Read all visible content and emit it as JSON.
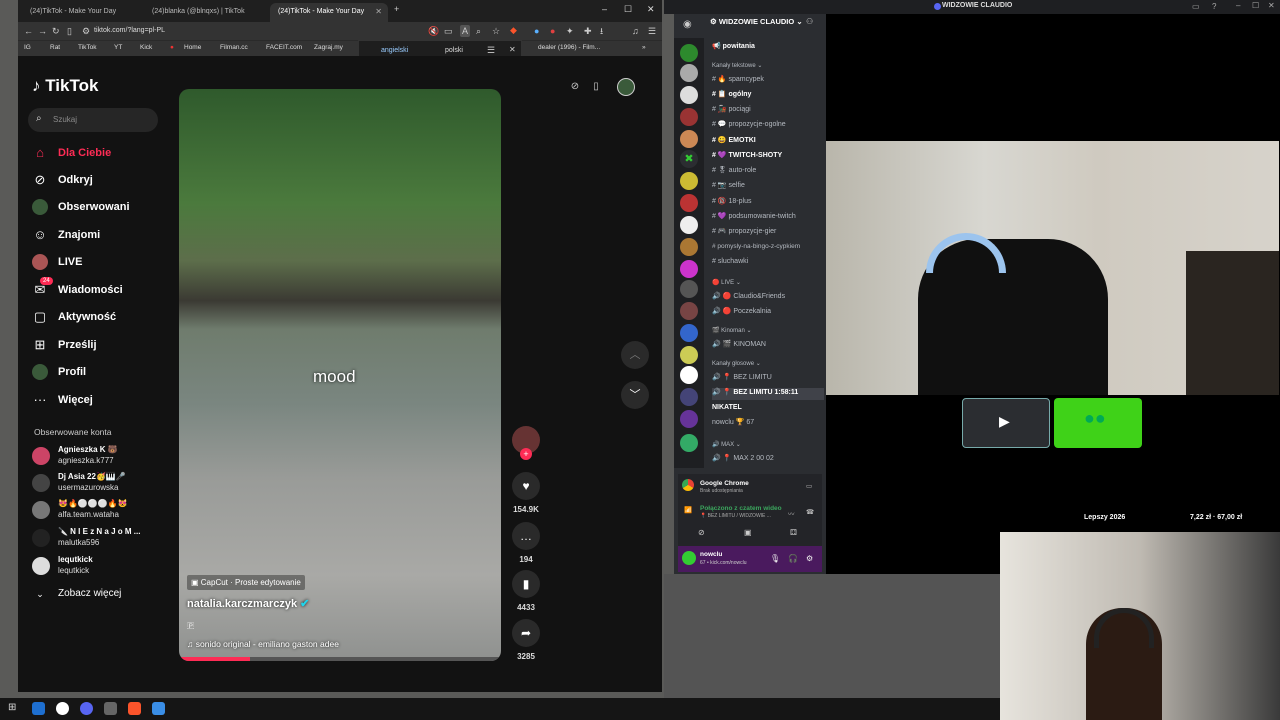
{
  "browser": {
    "tabs": [
      {
        "label": "(24)TikTok - Make Your Day"
      },
      {
        "label": "(24)blanka (@blnqxs) | TikTok"
      },
      {
        "label": "(24)TikTok - Make Your Day"
      }
    ],
    "new_tab": "+",
    "url": "tiktok.com/?lang=pl-PL",
    "bookmarks": [
      "IG",
      "Rat",
      "TikTok",
      "YT",
      "Kick",
      "",
      "Home",
      "Filman.cc",
      "FACEIT.com",
      "Zagraj.my",
      "dealer (1996) - Film..."
    ],
    "translate": {
      "lang1": "angielski",
      "lang2": "polski"
    },
    "window_controls": {
      "minimize": "–",
      "maximize": "☐",
      "close": "✕"
    }
  },
  "tiktok": {
    "logo": "TikTok",
    "search_placeholder": "Szukaj",
    "nav": [
      {
        "label": "Dla Ciebie",
        "icon": "home-icon",
        "active": true
      },
      {
        "label": "Odkryj",
        "icon": "compass-icon"
      },
      {
        "label": "Obserwowani",
        "icon": "following-icon"
      },
      {
        "label": "Znajomi",
        "icon": "friends-icon"
      },
      {
        "label": "LIVE",
        "icon": "live-icon"
      },
      {
        "label": "Wiadomości",
        "icon": "inbox-icon",
        "badge": "24"
      },
      {
        "label": "Aktywność",
        "icon": "activity-icon"
      },
      {
        "label": "Prześlij",
        "icon": "upload-icon"
      },
      {
        "label": "Profil",
        "icon": "profile-icon"
      },
      {
        "label": "Więcej",
        "icon": "more-icon"
      }
    ],
    "following_title": "Obserwowane konta",
    "following": [
      {
        "name": "Agnieszka K 🐻",
        "handle": "agnieszka.k777"
      },
      {
        "name": "Dj Asia 22🥳🎹🎤",
        "handle": "usermazurowska"
      },
      {
        "name": "😻🔥⚪⚪⚪🔥😻",
        "handle": "alfa.team.wataha"
      },
      {
        "name": "🔪 N I E z N a J o M ...",
        "handle": "malutka596"
      },
      {
        "name": "lequtkick",
        "handle": "lequtkick"
      }
    ],
    "see_more": "Zobacz więcej",
    "video": {
      "overlay_text": "mood",
      "capcut": "CapCut · Proste edytowanie",
      "author": "natalia.karczmarczyk",
      "caption": "🇵",
      "sound": "sonido original - emiliano gaston adee",
      "progress": 0.22
    },
    "actions": [
      {
        "icon": "heart-icon",
        "value": "154.9K"
      },
      {
        "icon": "comment-icon",
        "value": "194"
      },
      {
        "icon": "bookmark-icon",
        "value": "4433"
      },
      {
        "icon": "share-icon",
        "value": "3285"
      }
    ]
  },
  "discord": {
    "title": "WIDZOWIE CLAUDIO",
    "server": "WIDZOWIE CLAUDIO",
    "channels": [
      {
        "label": "📢 powitania",
        "style": "bold"
      },
      {
        "label": "Kanały tekstowe ⌄",
        "style": "cat"
      },
      {
        "label": "# 🔥 spamcypek"
      },
      {
        "label": "# 📋 ogólny",
        "style": "bold"
      },
      {
        "label": "# 🚂 pociągi"
      },
      {
        "label": "# 💬 propozycje-ogolne"
      },
      {
        "label": "# 😀 EMOTKI",
        "style": "bold"
      },
      {
        "label": "# 💜 TWITCH-SHOTY",
        "style": "bold"
      },
      {
        "label": "# 🎖 auto-role"
      },
      {
        "label": "# 📷 selfie"
      },
      {
        "label": "# 🔞 18-plus"
      },
      {
        "label": "# 💜 podsumowanie-twitch"
      },
      {
        "label": "# 🎮 propozycje-gier"
      },
      {
        "label": "# pomysly-na-bingo-z-cypkiem"
      },
      {
        "label": "# sluchawki"
      },
      {
        "label": "🔴 LIVE ⌄",
        "style": "cat"
      },
      {
        "label": "🔊 🔴 Claudio&Friends"
      },
      {
        "label": "🔊 🔴 Poczekalnia"
      },
      {
        "label": "🎬 Kinoman ⌄",
        "style": "cat"
      },
      {
        "label": "🔊 🎬 KINOMAN"
      },
      {
        "label": "Kanały głosowe ⌄",
        "style": "cat"
      },
      {
        "label": "🔊 📍 BEZ LIMITU"
      },
      {
        "label": "🔊 📍 BEZ LIMITU   1:58:11",
        "style": "sel"
      },
      {
        "label": "    NIKATEL",
        "style": "bold"
      },
      {
        "label": "    nowclu  🏆 67"
      },
      {
        "label": "🔊 MAX ⌄",
        "style": "cat"
      },
      {
        "label": "🔊 📍 MAX 2   00  02"
      }
    ],
    "panel": {
      "app": "Google Chrome",
      "app_sub": "Brak udostępniania",
      "connected": "Połączono z czatem wideo",
      "channel": "📍 BEZ LIMITU / WIDZOWIE ...",
      "user": "nowclu",
      "user_sub": "67 • kick.com/nowclu"
    },
    "overlay_counter": "Lepszy 2026",
    "overlay_money": "7,22 zł · 67,00 zł"
  }
}
